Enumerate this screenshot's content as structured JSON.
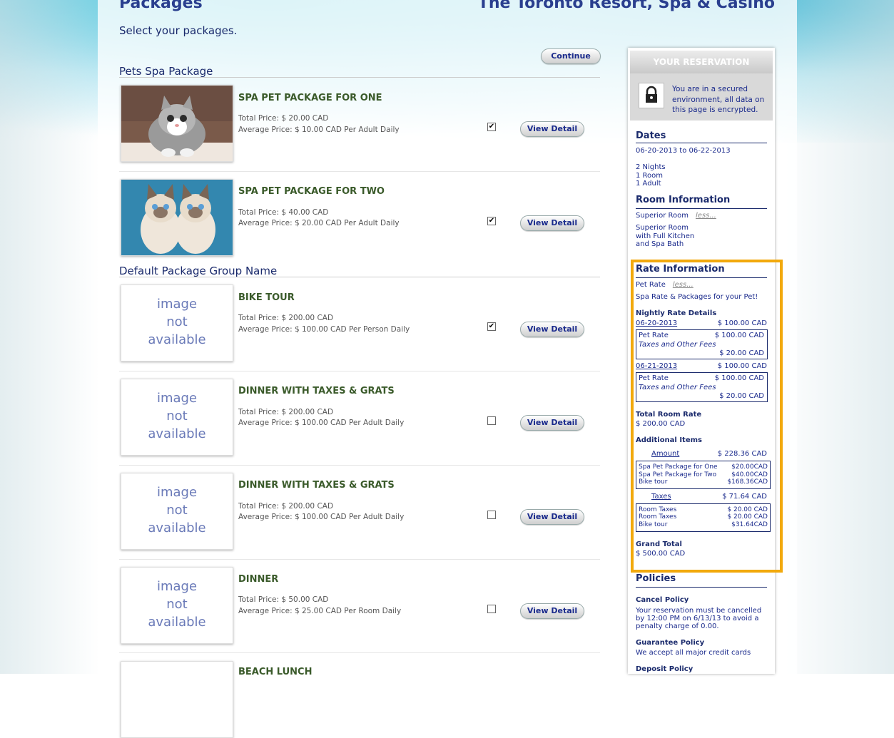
{
  "header": {
    "title": "Packages",
    "hotel": "The Toronto Resort, Spa & Casino",
    "subtitle": "Select your packages.",
    "continue_label": "Continue"
  },
  "groups": [
    {
      "name": "Pets Spa Package"
    },
    {
      "name": "Default Package Group Name"
    }
  ],
  "packages": [
    {
      "name": "SPA PET PACKAGE FOR ONE",
      "total": "Total Price: $ 20.00 CAD",
      "average": "Average Price: $ 10.00 CAD   Per Adult  Daily",
      "checked": true,
      "image": "kitten-photo"
    },
    {
      "name": "SPA PET PACKAGE FOR TWO",
      "total": "Total Price: $ 40.00 CAD",
      "average": "Average Price: $ 20.00 CAD   Per Adult  Daily",
      "checked": true,
      "image": "two-kittens-photo"
    },
    {
      "name": "BIKE TOUR",
      "total": "Total Price: $ 200.00 CAD",
      "average": "Average Price: $ 100.00 CAD   Per Person  Daily",
      "checked": true,
      "image": "na"
    },
    {
      "name": "DINNER WITH TAXES & GRATS",
      "total": "Total Price: $ 200.00 CAD",
      "average": "Average Price: $ 100.00 CAD   Per Adult  Daily",
      "checked": false,
      "image": "na"
    },
    {
      "name": "DINNER WITH TAXES & GRATS",
      "total": "Total Price: $ 200.00 CAD",
      "average": "Average Price: $ 100.00 CAD   Per Adult  Daily",
      "checked": false,
      "image": "na"
    },
    {
      "name": "DINNER",
      "total": "Total Price: $ 50.00 CAD",
      "average": "Average Price: $ 25.00 CAD   Per Room  Daily",
      "checked": false,
      "image": "na"
    },
    {
      "name": "BEACH LUNCH"
    }
  ],
  "image_na": {
    "l1": "image",
    "l2": "not",
    "l3": "available"
  },
  "view_detail_label": "View Detail",
  "checkmark": "✔",
  "sidebar": {
    "header": "YOUR RESERVATION",
    "secure": "You are in a secured environment, all data on this page is encrypted.",
    "dates_title": "Dates",
    "dates_range": "06-20-2013  to  06-22-2013",
    "nights": "2  Nights",
    "rooms": "1  Room",
    "adults": "1  Adult",
    "room_title": "Room Information",
    "room_name": "Superior Room",
    "less": "less...",
    "room_desc_1": "Superior Room",
    "room_desc_2": "with Full Kitchen",
    "room_desc_3": "and Spa Bath",
    "rate_title": "Rate Information",
    "rate_name": "Pet Rate",
    "rate_desc": "Spa Rate & Packages for your Pet!",
    "nightly_title": "Nightly Rate Details",
    "nights_detail": [
      {
        "date": "06-20-2013",
        "total": "$ 100.00 CAD",
        "rate_label": "Pet Rate",
        "rate": "$ 100.00 CAD",
        "tax_label": "Taxes and Other Fees",
        "tax": "$ 20.00 CAD"
      },
      {
        "date": "06-21-2013",
        "total": "$ 100.00 CAD",
        "rate_label": "Pet Rate",
        "rate": "$ 100.00 CAD",
        "tax_label": "Taxes and Other Fees",
        "tax": "$ 20.00 CAD"
      }
    ],
    "total_room_title": "Total Room Rate",
    "total_room": "$ 200.00 CAD",
    "additional_title": "Additional Items",
    "amount_label": "Amount",
    "amount": "$ 228.36 CAD",
    "amount_items": [
      {
        "name": "Spa Pet Package for One",
        "value": "$20.00CAD"
      },
      {
        "name": "Spa Pet Package for Two",
        "value": "$40.00CAD"
      },
      {
        "name": "Bike tour",
        "value": "$168.36CAD"
      }
    ],
    "taxes_label": "Taxes",
    "taxes": "$ 71.64 CAD",
    "tax_items": [
      {
        "name": "Room Taxes",
        "value": "$ 20.00 CAD"
      },
      {
        "name": "Room Taxes",
        "value": "$ 20.00 CAD"
      },
      {
        "name": "Bike tour",
        "value": "$31.64CAD"
      }
    ],
    "grand_title": "Grand Total",
    "grand": "$ 500.00 CAD",
    "policies_title": "Policies",
    "cancel_title": "Cancel Policy",
    "cancel_1": "Your reservation must be cancelled",
    "cancel_2": "by 12:00 PM on 6/13/13 to avoid a",
    "cancel_3": "penalty charge of 0.00.",
    "guarantee_title": "Guarantee Policy",
    "guarantee": "We accept all major credit cards",
    "deposit_title": "Deposit Policy"
  }
}
